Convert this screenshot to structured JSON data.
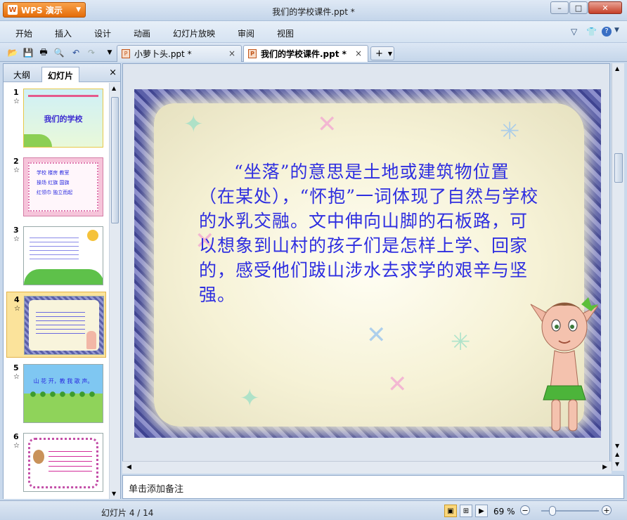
{
  "app": {
    "button_label": "WPS 演示",
    "window_title": "我们的学校课件.ppt *"
  },
  "window_controls": {
    "minimize": "–",
    "maximize": "□",
    "close": "✕"
  },
  "menu": {
    "items": [
      "开始",
      "插入",
      "设计",
      "动画",
      "幻灯片放映",
      "审阅",
      "视图"
    ],
    "help": "?"
  },
  "tabs": [
    {
      "label": "小萝卜头.ppt *",
      "active": false,
      "close": "×"
    },
    {
      "label": "我们的学校课件.ppt *",
      "active": true,
      "close": "×"
    }
  ],
  "new_tab": "+",
  "panel": {
    "tabs": [
      "大纲",
      "幻灯片"
    ],
    "close": "×",
    "thumbnails": [
      {
        "number": "1",
        "text": "我们的学校",
        "star": "☆"
      },
      {
        "number": "2",
        "text": "学校 楼房 教室\n操场 红旗 国旗\n红领巾 独立而起",
        "star": "☆"
      },
      {
        "number": "3",
        "text": "",
        "star": "☆"
      },
      {
        "number": "4",
        "text": "",
        "star": "☆"
      },
      {
        "number": "5",
        "text": "山 花 开，教 我 歌 声。",
        "star": "☆"
      },
      {
        "number": "6",
        "text": "",
        "star": "☆"
      }
    ]
  },
  "slide": {
    "text": "“坐落”的意思是土地或建筑物位置（在某处），“怀抱”一词体现了自然与学校的水乳交融。文中伸向山脚的石板路，可以想象到山村的孩子们是怎样上学、回家的，感受他们跋山涉水去求学的艰辛与坚强。"
  },
  "notes": {
    "placeholder": "单击添加备注"
  },
  "status": {
    "slide_info": "幻灯片 4 / 14",
    "zoom": "69 %",
    "zoom_fraction": 0.2
  },
  "colors": {
    "accent": "#e46c0a",
    "slide_text": "#2e2ee0",
    "selected_thumb": "#fbe39b"
  }
}
